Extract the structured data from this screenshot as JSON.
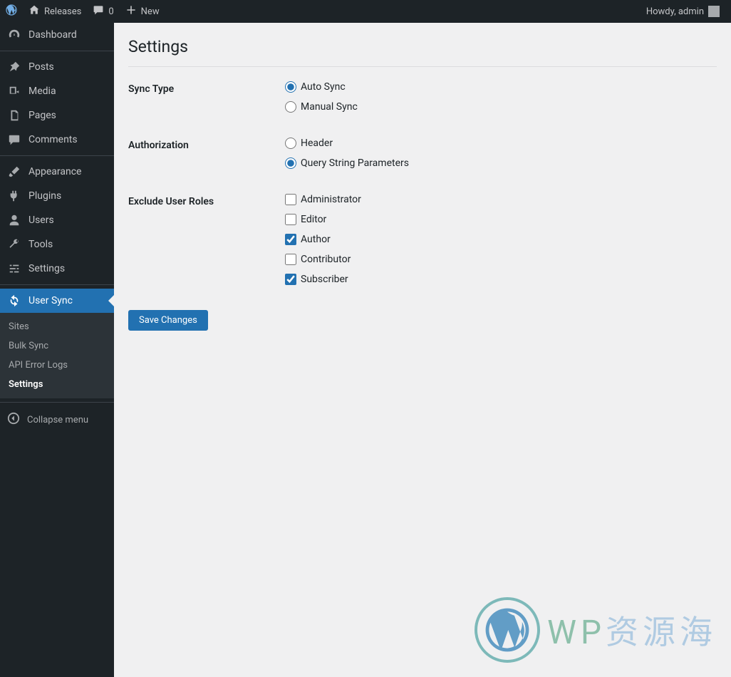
{
  "topbar": {
    "site_name": "Releases",
    "comment_count": "0",
    "new_label": "New",
    "howdy": "Howdy, admin"
  },
  "sidebar": {
    "dashboard": "Dashboard",
    "posts": "Posts",
    "media": "Media",
    "pages": "Pages",
    "comments": "Comments",
    "appearance": "Appearance",
    "plugins": "Plugins",
    "users": "Users",
    "tools": "Tools",
    "settings": "Settings",
    "user_sync": "User Sync",
    "collapse": "Collapse menu",
    "sub": {
      "sites": "Sites",
      "bulk_sync": "Bulk Sync",
      "api_error_logs": "API Error Logs",
      "settings": "Settings"
    }
  },
  "page": {
    "title": "Settings",
    "save": "Save Changes"
  },
  "form": {
    "sync_type": {
      "label": "Sync Type",
      "auto": "Auto Sync",
      "manual": "Manual Sync",
      "value": "auto"
    },
    "authorization": {
      "label": "Authorization",
      "header": "Header",
      "query": "Query String Parameters",
      "value": "query"
    },
    "exclude_roles": {
      "label": "Exclude User Roles",
      "administrator": {
        "label": "Administrator",
        "checked": false
      },
      "editor": {
        "label": "Editor",
        "checked": false
      },
      "author": {
        "label": "Author",
        "checked": true
      },
      "contributor": {
        "label": "Contributor",
        "checked": false
      },
      "subscriber": {
        "label": "Subscriber",
        "checked": true
      }
    }
  },
  "watermark": {
    "en": "WP",
    "cn": "资源海"
  }
}
